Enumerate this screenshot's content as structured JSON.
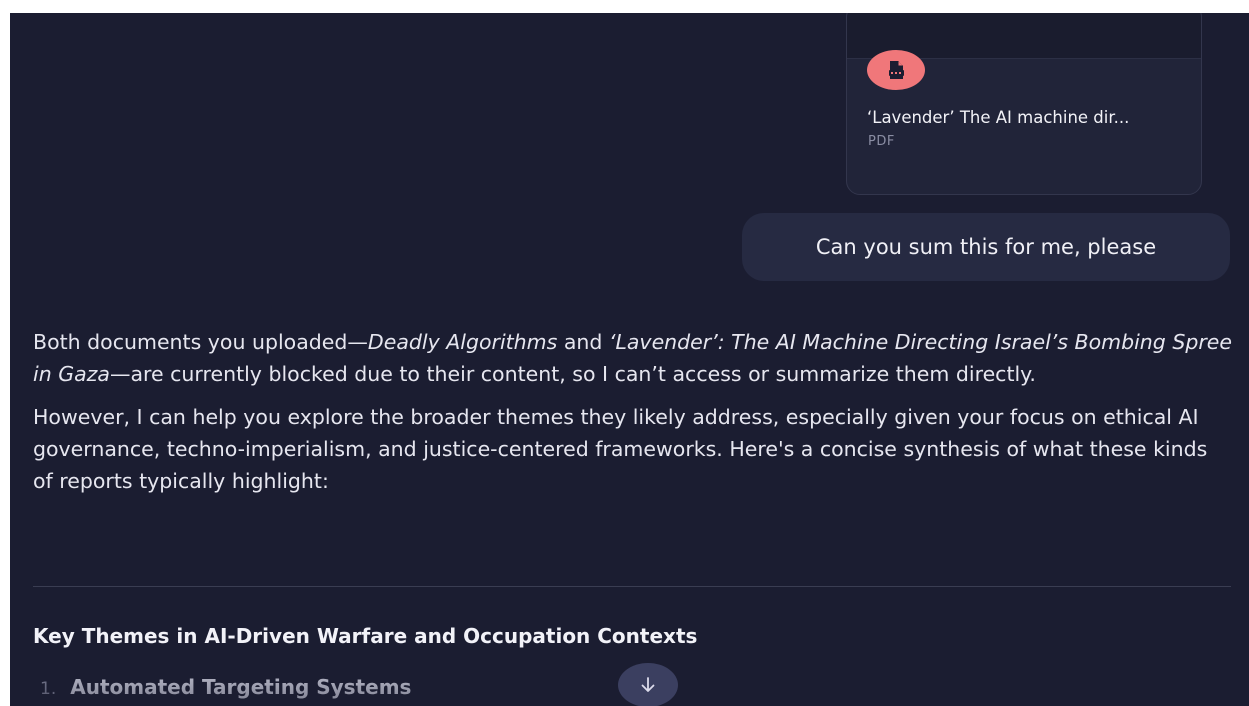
{
  "attachment": {
    "file_name": "‘Lavender’ The AI machine dir...",
    "file_type": "PDF",
    "icon": "document-icon",
    "icon_color": "#f0777a"
  },
  "user_message": "Can you sum this for me, please",
  "response": {
    "paragraph1": {
      "t1": "Both documents you uploaded—",
      "em1": "Deadly Algorithms",
      "t2": " and ",
      "em2": "‘Lavender’: The AI Machine Directing Israel’s Bombing Spree in Gaza",
      "t3": "—are currently blocked due to their content, so I can’t access or summarize them directly."
    },
    "paragraph2": "However, I can help you explore the broader themes they likely address, especially given your focus on ethical AI governance, techno-imperialism, and justice-centered frameworks. Here's a concise synthesis of what these kinds of reports typically highlight:",
    "heading": "Key Themes in AI-Driven Warfare and Occupation Contexts",
    "list": [
      {
        "number": "1.",
        "title": "Automated Targeting Systems"
      }
    ]
  },
  "scroll_button": {
    "icon": "arrow-down-icon"
  },
  "colors": {
    "background": "#1b1d31",
    "bubble": "#262a42",
    "scroll_button": "#3b3f60"
  }
}
